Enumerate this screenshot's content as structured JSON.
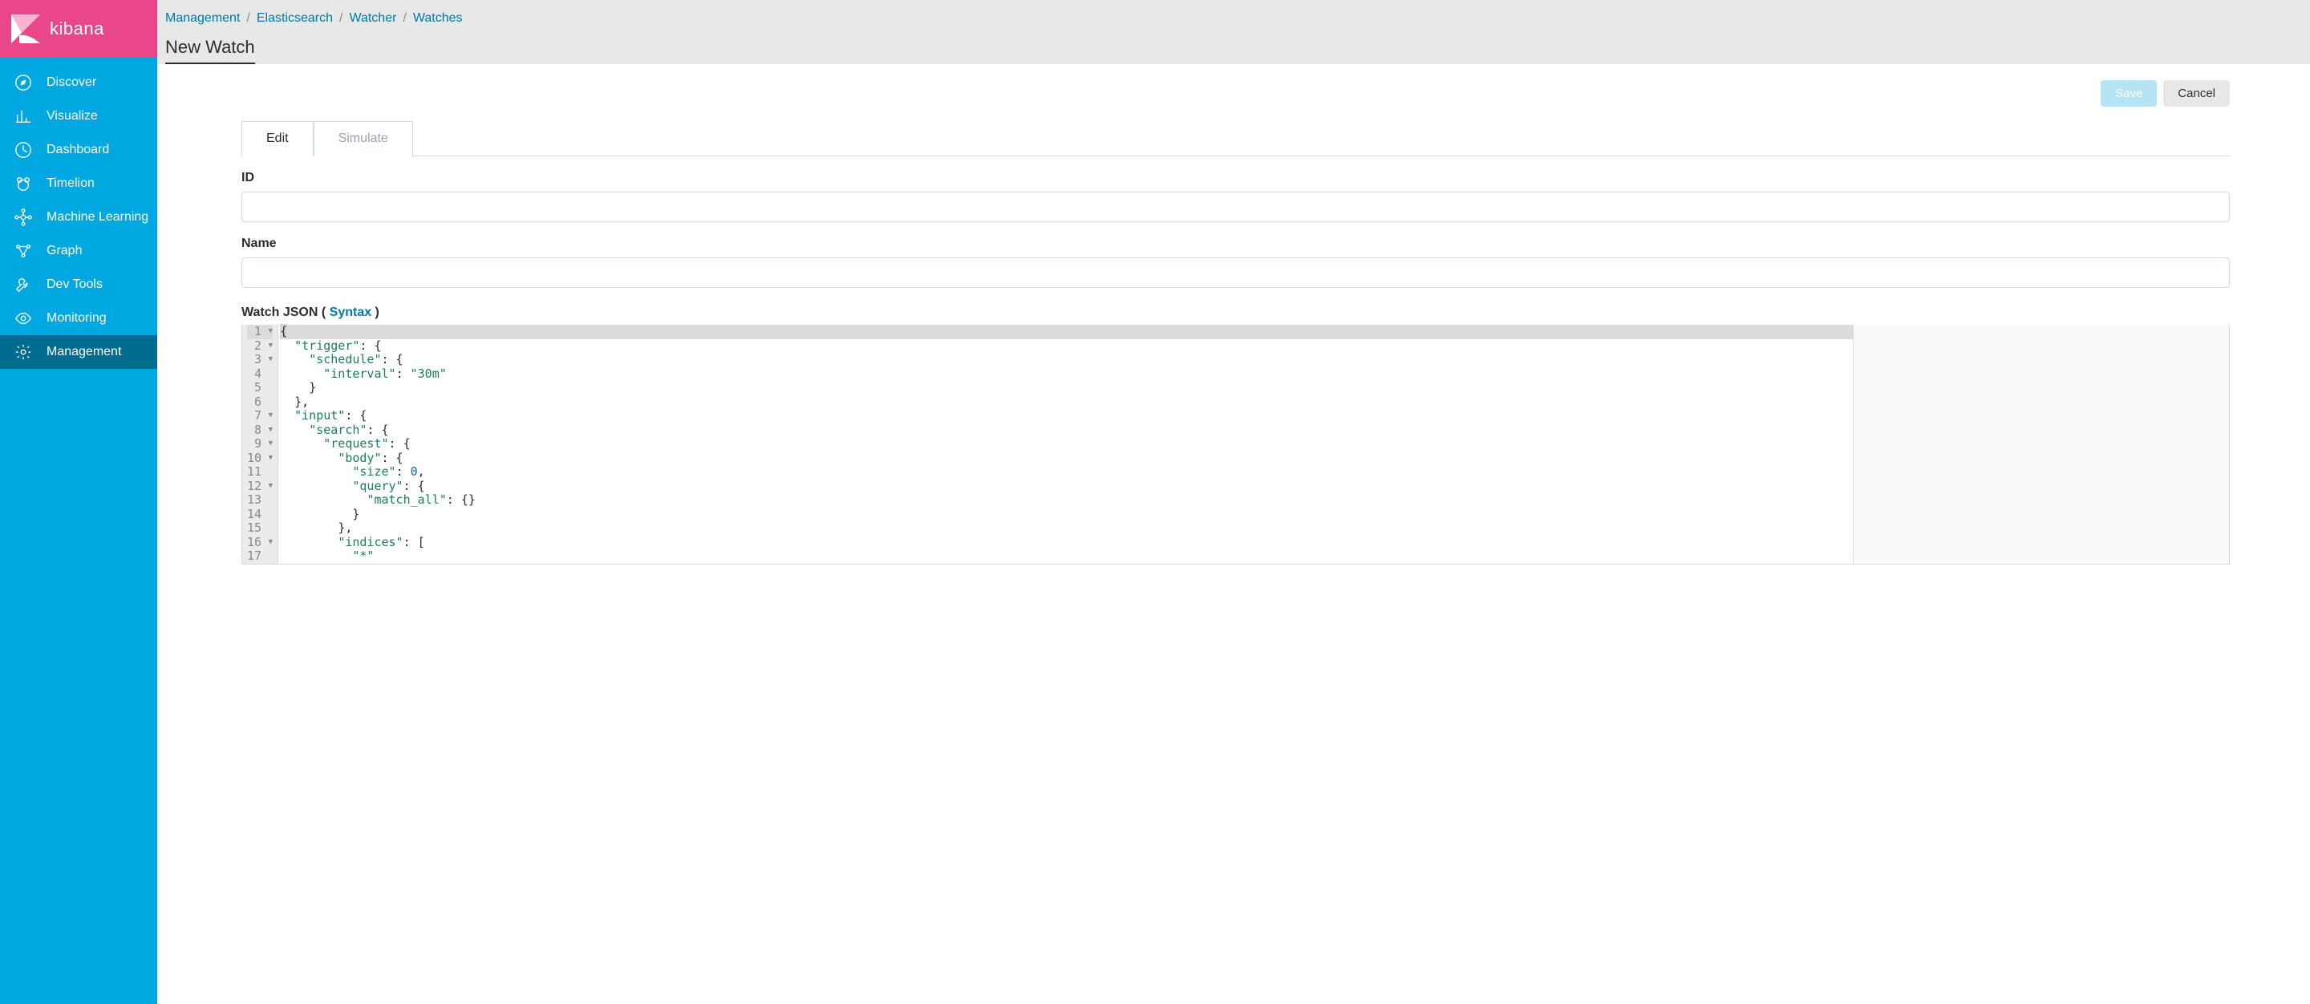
{
  "brand": {
    "name": "kibana"
  },
  "sidebar": {
    "items": [
      {
        "label": "Discover",
        "icon": "compass"
      },
      {
        "label": "Visualize",
        "icon": "barchart"
      },
      {
        "label": "Dashboard",
        "icon": "gauge"
      },
      {
        "label": "Timelion",
        "icon": "bear"
      },
      {
        "label": "Machine Learning",
        "icon": "ml"
      },
      {
        "label": "Graph",
        "icon": "graph"
      },
      {
        "label": "Dev Tools",
        "icon": "wrench"
      },
      {
        "label": "Monitoring",
        "icon": "eye"
      },
      {
        "label": "Management",
        "icon": "gear"
      }
    ],
    "active_index": 8
  },
  "breadcrumb": [
    {
      "label": "Management"
    },
    {
      "label": "Elasticsearch"
    },
    {
      "label": "Watcher"
    },
    {
      "label": "Watches"
    }
  ],
  "page_title": "New Watch",
  "actions": {
    "save": "Save",
    "cancel": "Cancel"
  },
  "tabs": [
    {
      "label": "Edit",
      "active": true
    },
    {
      "label": "Simulate",
      "active": false
    }
  ],
  "form": {
    "id_label": "ID",
    "id_value": "",
    "name_label": "Name",
    "name_value": "",
    "json_label_prefix": "Watch JSON ( ",
    "json_syntax_link": "Syntax",
    "json_label_suffix": " )"
  },
  "editor": {
    "lines": [
      {
        "n": 1,
        "fold": true,
        "tokens": [
          [
            "punc",
            "{"
          ]
        ]
      },
      {
        "n": 2,
        "fold": true,
        "tokens": [
          [
            "ind",
            1
          ],
          [
            "key",
            "\"trigger\""
          ],
          [
            "punc",
            ": {"
          ]
        ]
      },
      {
        "n": 3,
        "fold": true,
        "tokens": [
          [
            "ind",
            2
          ],
          [
            "key",
            "\"schedule\""
          ],
          [
            "punc",
            ": {"
          ]
        ]
      },
      {
        "n": 4,
        "fold": false,
        "tokens": [
          [
            "ind",
            3
          ],
          [
            "key",
            "\"interval\""
          ],
          [
            "punc",
            ": "
          ],
          [
            "str",
            "\"30m\""
          ]
        ]
      },
      {
        "n": 5,
        "fold": false,
        "tokens": [
          [
            "ind",
            2
          ],
          [
            "punc",
            "}"
          ]
        ]
      },
      {
        "n": 6,
        "fold": false,
        "tokens": [
          [
            "ind",
            1
          ],
          [
            "punc",
            "},"
          ]
        ]
      },
      {
        "n": 7,
        "fold": true,
        "tokens": [
          [
            "ind",
            1
          ],
          [
            "key",
            "\"input\""
          ],
          [
            "punc",
            ": {"
          ]
        ]
      },
      {
        "n": 8,
        "fold": true,
        "tokens": [
          [
            "ind",
            2
          ],
          [
            "key",
            "\"search\""
          ],
          [
            "punc",
            ": {"
          ]
        ]
      },
      {
        "n": 9,
        "fold": true,
        "tokens": [
          [
            "ind",
            3
          ],
          [
            "key",
            "\"request\""
          ],
          [
            "punc",
            ": {"
          ]
        ]
      },
      {
        "n": 10,
        "fold": true,
        "tokens": [
          [
            "ind",
            4
          ],
          [
            "key",
            "\"body\""
          ],
          [
            "punc",
            ": {"
          ]
        ]
      },
      {
        "n": 11,
        "fold": false,
        "tokens": [
          [
            "ind",
            5
          ],
          [
            "key",
            "\"size\""
          ],
          [
            "punc",
            ": "
          ],
          [
            "num",
            "0"
          ],
          [
            "punc",
            ","
          ]
        ]
      },
      {
        "n": 12,
        "fold": true,
        "tokens": [
          [
            "ind",
            5
          ],
          [
            "key",
            "\"query\""
          ],
          [
            "punc",
            ": {"
          ]
        ]
      },
      {
        "n": 13,
        "fold": false,
        "tokens": [
          [
            "ind",
            6
          ],
          [
            "key",
            "\"match_all\""
          ],
          [
            "punc",
            ": {}"
          ]
        ]
      },
      {
        "n": 14,
        "fold": false,
        "tokens": [
          [
            "ind",
            5
          ],
          [
            "punc",
            "}"
          ]
        ]
      },
      {
        "n": 15,
        "fold": false,
        "tokens": [
          [
            "ind",
            4
          ],
          [
            "punc",
            "},"
          ]
        ]
      },
      {
        "n": 16,
        "fold": true,
        "tokens": [
          [
            "ind",
            4
          ],
          [
            "key",
            "\"indices\""
          ],
          [
            "punc",
            ": ["
          ]
        ]
      },
      {
        "n": 17,
        "fold": false,
        "tokens": [
          [
            "ind",
            5
          ],
          [
            "str",
            "\"*\""
          ]
        ]
      }
    ]
  }
}
